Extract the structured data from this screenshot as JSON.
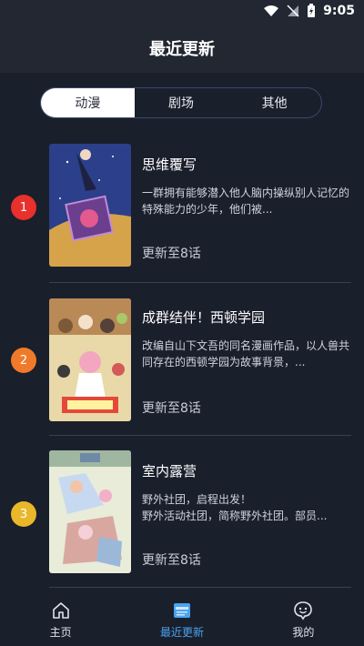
{
  "status_bar": {
    "time": "9:05"
  },
  "header": {
    "title": "最近更新"
  },
  "tabs": [
    {
      "label": "动漫",
      "active": true
    },
    {
      "label": "剧场",
      "active": false
    },
    {
      "label": "其他",
      "active": false
    }
  ],
  "items": [
    {
      "rank": "1",
      "title": "思维覆写",
      "description": "一群拥有能够潜入他人脑内操纵别人记忆的特殊能力的少年，他们被...",
      "episode": "更新至8话",
      "rank_color": "#e8302c"
    },
    {
      "rank": "2",
      "title": "成群结伴！西顿学园",
      "description": "改编自山下文吾的同名漫画作品，以人兽共同存在的西顿学园为故事背景，...",
      "episode": "更新至8话",
      "rank_color": "#f07a2a"
    },
    {
      "rank": "3",
      "title": "室内露营",
      "description": "野外社团，启程出发！\n野外活动社团，简称野外社团。部员...",
      "episode": "更新至8话",
      "rank_color": "#e8b82a"
    }
  ],
  "bottom_nav": [
    {
      "label": "主页",
      "icon": "home-icon",
      "active": false
    },
    {
      "label": "最近更新",
      "icon": "news-icon",
      "active": true
    },
    {
      "label": "我的",
      "icon": "profile-icon",
      "active": false
    }
  ],
  "colors": {
    "accent": "#4aa3ef",
    "background": "#1a1f2c"
  }
}
